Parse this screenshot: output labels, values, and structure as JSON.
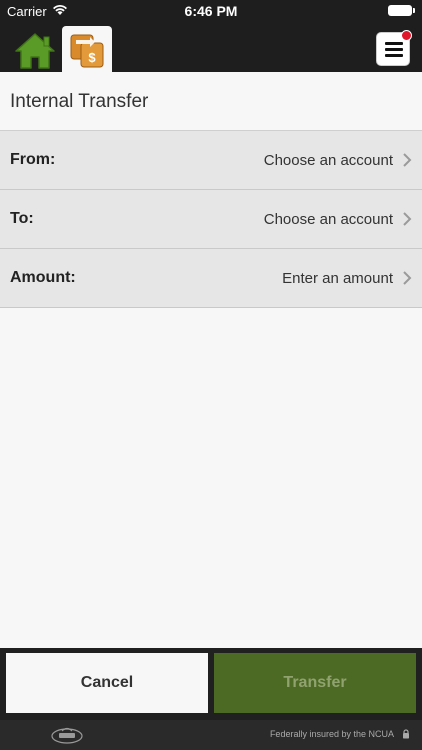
{
  "status_bar": {
    "carrier": "Carrier",
    "time": "6:46 PM"
  },
  "header": {
    "home_icon": "home-icon",
    "transfer_icon": "transfer-dollar-icon",
    "menu_icon": "hamburger-menu-icon",
    "notification_dot": true
  },
  "page": {
    "title": "Internal Transfer"
  },
  "form": {
    "rows": [
      {
        "label": "From:",
        "value": "Choose an account"
      },
      {
        "label": "To:",
        "value": "Choose an account"
      },
      {
        "label": "Amount:",
        "value": "Enter an amount"
      }
    ]
  },
  "actions": {
    "cancel_label": "Cancel",
    "transfer_label": "Transfer"
  },
  "footer": {
    "insured_text": "Federally insured by the NCUA",
    "logo_icon": "credit-union-logo",
    "lock_icon": "lock-icon"
  },
  "colors": {
    "header_bg": "#1e1e1e",
    "home_green": "#5a9a27",
    "transfer_orange": "#d98a2b",
    "transfer_button": "#4d6a24",
    "badge_red": "#e0172b"
  }
}
